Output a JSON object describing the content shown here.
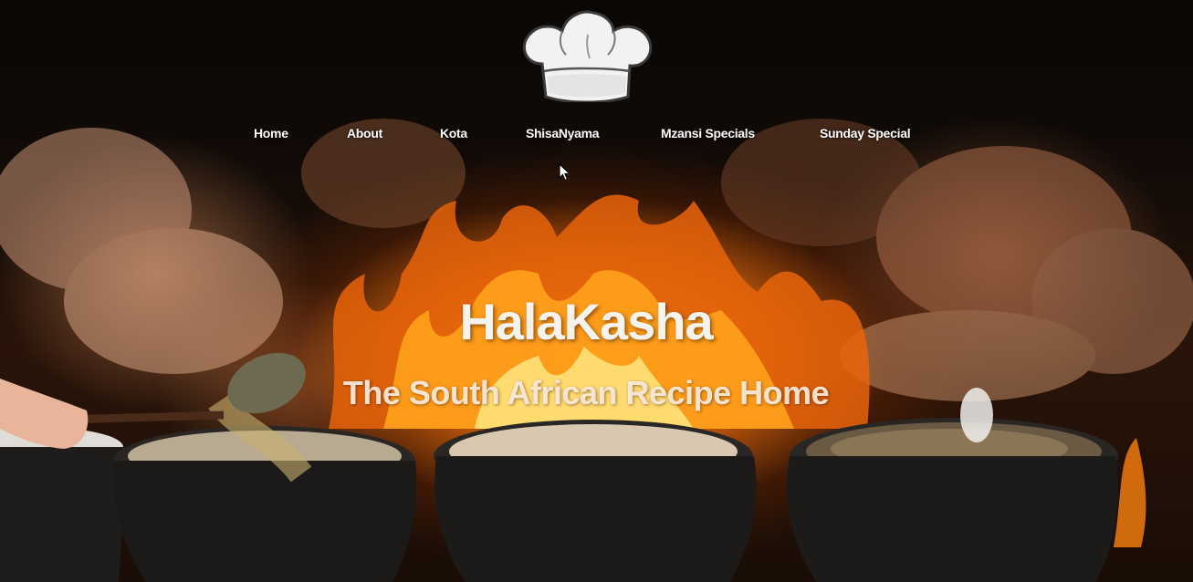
{
  "site": {
    "logo_icon": "chef-hat-icon",
    "title": "HalaKasha",
    "subtitle": "The South African Recipe Home"
  },
  "nav": {
    "items": [
      {
        "label": "Home"
      },
      {
        "label": "About"
      },
      {
        "label": "Kota"
      },
      {
        "label": "ShisaNyama"
      },
      {
        "label": "Mzansi Specials"
      },
      {
        "label": "Sunday Special"
      }
    ]
  },
  "colors": {
    "background": "#0c0805",
    "flame_core": "#ffd24a",
    "flame_outer": "#f07a10",
    "pot_iron": "#1d1b1a",
    "text": "#ffffff"
  }
}
